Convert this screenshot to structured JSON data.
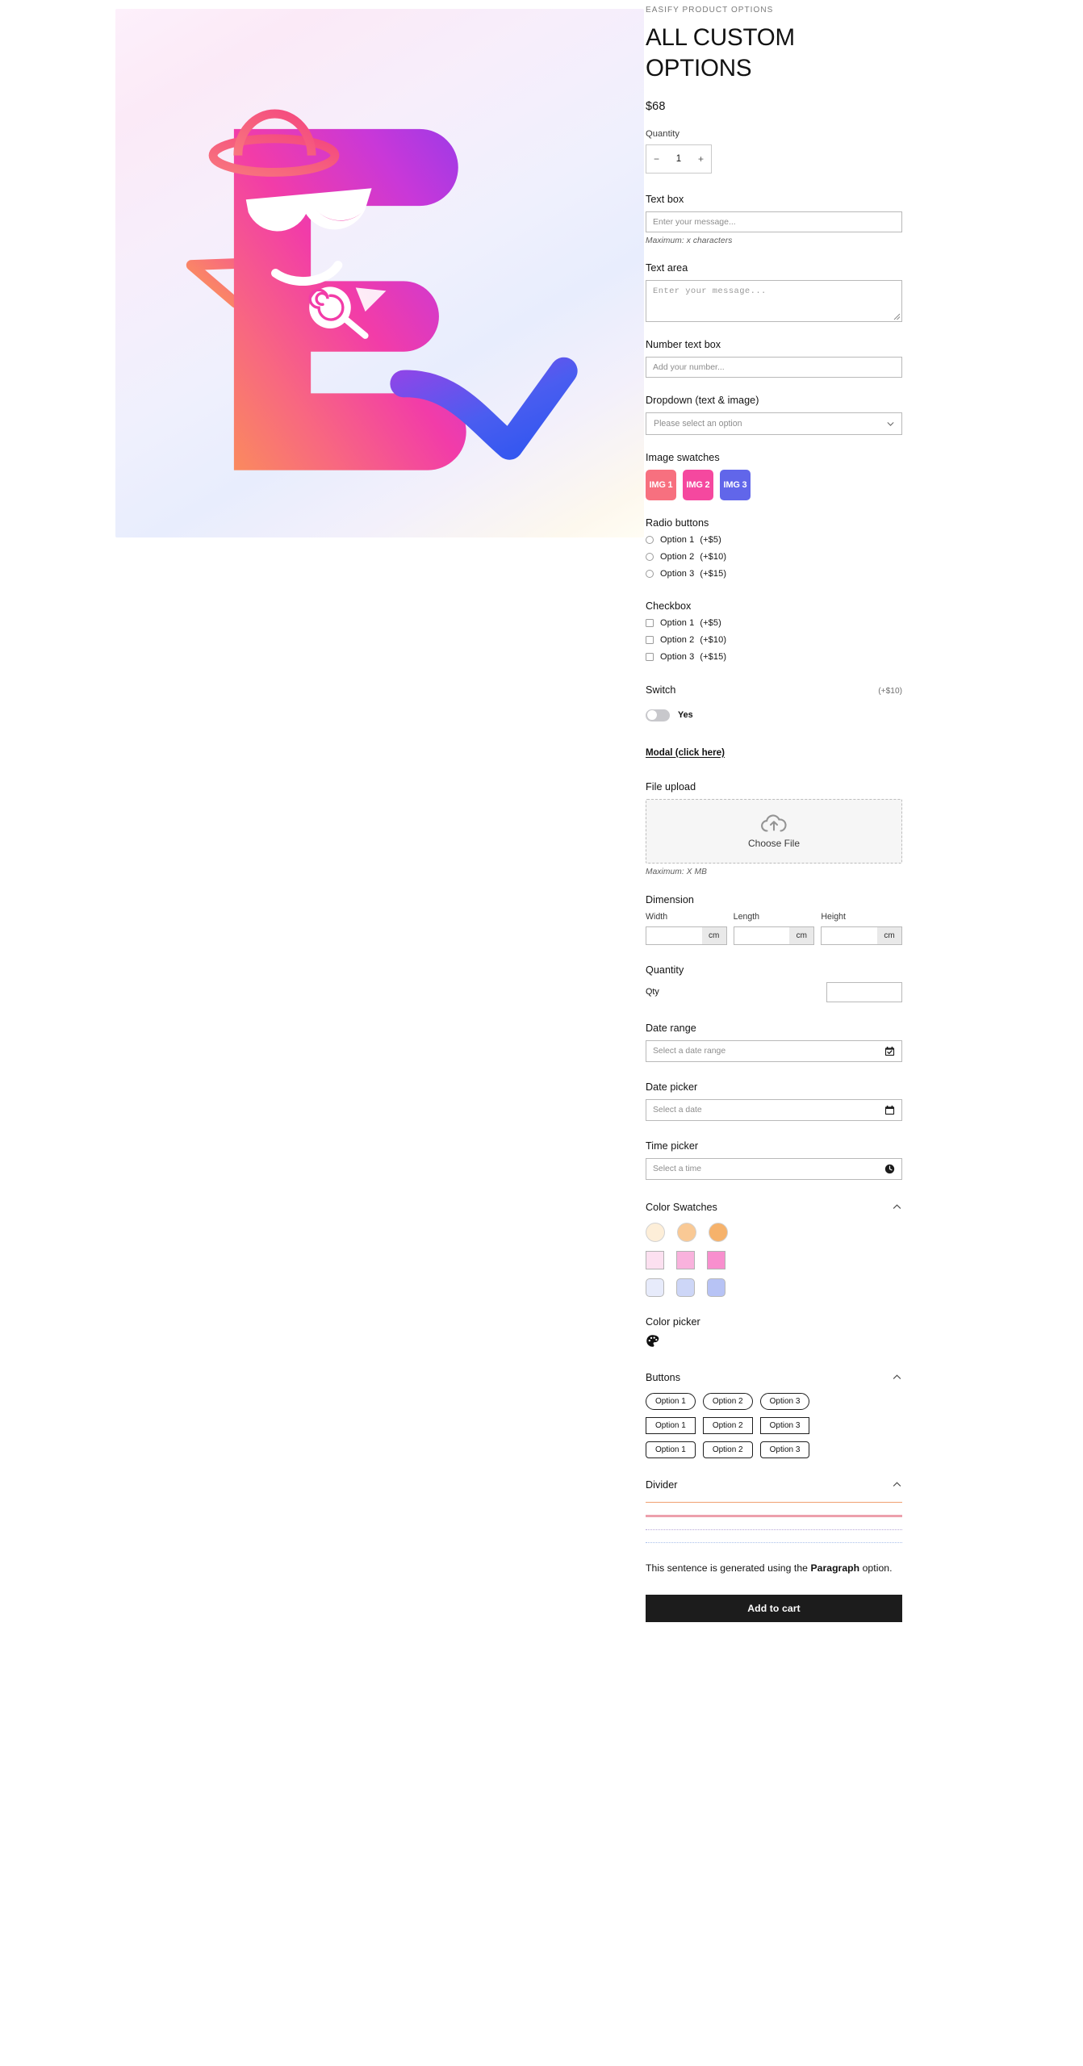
{
  "product": {
    "vendor": "EASIFY PRODUCT OPTIONS",
    "title": "ALL CUSTOM OPTIONS",
    "price": "$68",
    "image_alt": "easify-logo-letter-e-character"
  },
  "quantity": {
    "label": "Quantity",
    "minus": "−",
    "value": "1",
    "plus": "+"
  },
  "text_box": {
    "label": "Text box",
    "placeholder": "Enter your message...",
    "helper": "Maximum: x characters"
  },
  "text_area": {
    "label": "Text area",
    "placeholder": "Enter your message..."
  },
  "number_box": {
    "label": "Number text box",
    "placeholder": "Add your number..."
  },
  "dropdown": {
    "label": "Dropdown (text & image)",
    "selected": "Please select an option"
  },
  "image_swatches": {
    "label": "Image swatches",
    "items": [
      {
        "text": "IMG 1",
        "color": "#f7707f"
      },
      {
        "text": "IMG 2",
        "color": "#f5489f"
      },
      {
        "text": "IMG 3",
        "color": "#6166ea"
      }
    ]
  },
  "radio": {
    "label": "Radio buttons",
    "options": [
      {
        "label": "Option 1",
        "price": "(+$5)"
      },
      {
        "label": "Option 2",
        "price": "(+$10)"
      },
      {
        "label": "Option 3",
        "price": "(+$15)"
      }
    ]
  },
  "checkbox": {
    "label": "Checkbox",
    "options": [
      {
        "label": "Option 1",
        "price": "(+$5)"
      },
      {
        "label": "Option 2",
        "price": "(+$10)"
      },
      {
        "label": "Option 3",
        "price": "(+$15)"
      }
    ]
  },
  "switch": {
    "label": "Switch",
    "price": "(+$10)",
    "state_text": "Yes",
    "checked": false
  },
  "modal": {
    "link_text": "Modal (click here)"
  },
  "file_upload": {
    "label": "File upload",
    "button_text": "Choose File",
    "helper": "Maximum: X MB",
    "icon": "cloud-upload-icon"
  },
  "dimension": {
    "label": "Dimension",
    "fields": [
      {
        "name": "Width",
        "value": "",
        "unit": "cm"
      },
      {
        "name": "Length",
        "value": "",
        "unit": "cm"
      },
      {
        "name": "Height",
        "value": "",
        "unit": "cm"
      }
    ]
  },
  "quantity_section": {
    "label": "Quantity",
    "row_label": "Qty",
    "value": ""
  },
  "date_range": {
    "label": "Date range",
    "placeholder": "Select a date range",
    "icon": "calendar-check-icon"
  },
  "date_picker": {
    "label": "Date picker",
    "placeholder": "Select a date",
    "icon": "calendar-icon"
  },
  "time_picker": {
    "label": "Time picker",
    "placeholder": "Select a time",
    "icon": "clock-icon"
  },
  "color_swatches": {
    "label": "Color Swatches",
    "collapse_icon": "chevron-up-icon",
    "rows": [
      {
        "shape": "circle",
        "colors": [
          "#fdeed8",
          "#f9c995",
          "#f6b26b"
        ]
      },
      {
        "shape": "square",
        "colors": [
          "#fce0f0",
          "#f9b2dd",
          "#f88fce"
        ]
      },
      {
        "shape": "rounded",
        "colors": [
          "#e7ebfb",
          "#cdd6f7",
          "#b7c3f5"
        ]
      }
    ]
  },
  "color_picker": {
    "label": "Color picker",
    "icon": "palette-icon"
  },
  "buttons": {
    "label": "Buttons",
    "collapse_icon": "chevron-up-icon",
    "rows": [
      {
        "style": "pill",
        "options": [
          "Option 1",
          "Option 2",
          "Option 3"
        ]
      },
      {
        "style": "sq",
        "options": [
          "Option 1",
          "Option 2",
          "Option 3"
        ]
      },
      {
        "style": "rnd",
        "options": [
          "Option 1",
          "Option 2",
          "Option 3"
        ]
      }
    ]
  },
  "divider": {
    "label": "Divider",
    "collapse_icon": "chevron-up-icon",
    "lines": [
      {
        "style": "solid",
        "color": "#f0a070",
        "thickness": "1px"
      },
      {
        "style": "solid",
        "color": "#eda0ac",
        "thickness": "3px"
      },
      {
        "style": "dotted",
        "color": "#b8a8d8",
        "thickness": "1px"
      },
      {
        "style": "dotted",
        "color": "#a8c0ea",
        "thickness": "1px"
      }
    ]
  },
  "paragraph": {
    "text_before": "This sentence is generated using the ",
    "bold": "Paragraph",
    "text_after": " option."
  },
  "add_to_cart": {
    "label": "Add to cart"
  }
}
